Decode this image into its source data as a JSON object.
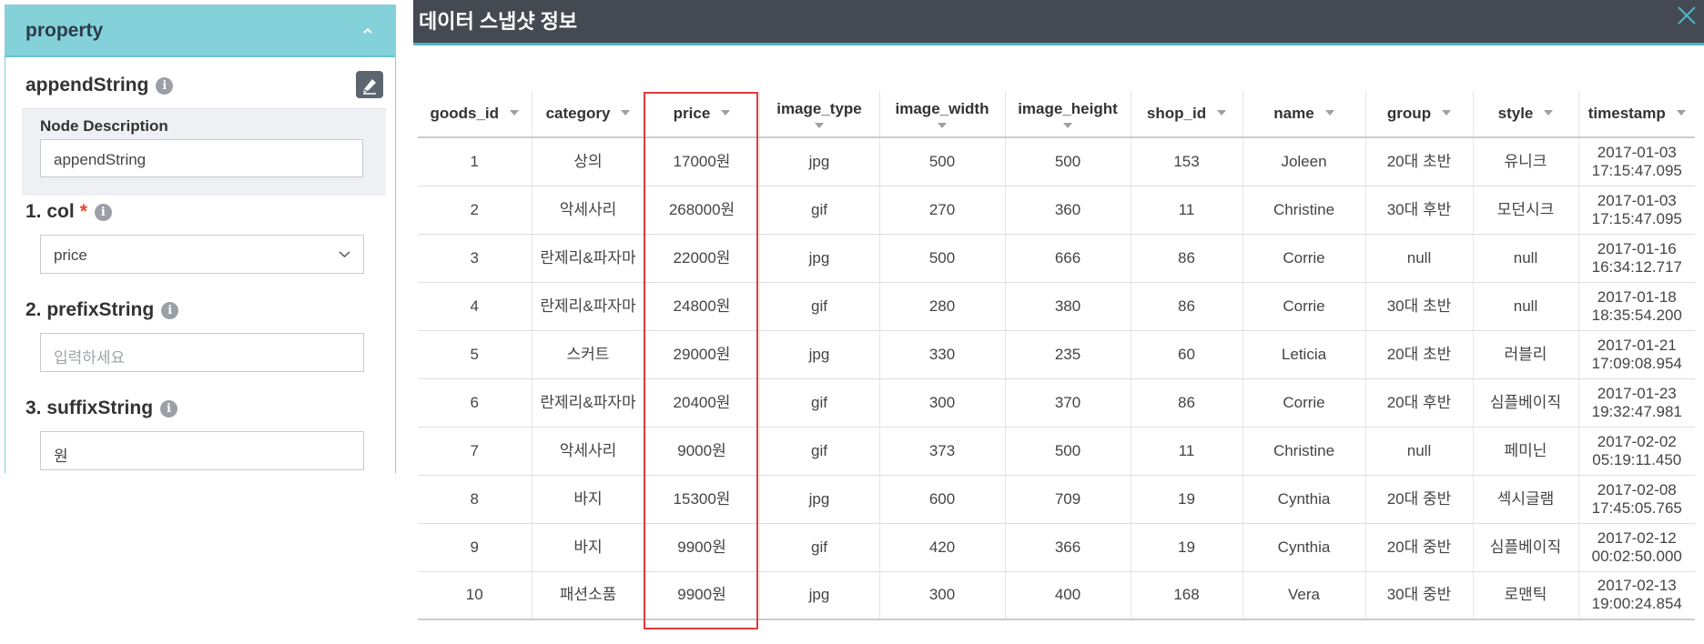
{
  "property_panel": {
    "title": "property",
    "node_name": "appendString",
    "description_label": "Node Description",
    "description_value": "appendString",
    "fields": [
      {
        "label": "1. col",
        "required": "*",
        "value": "price"
      },
      {
        "label": "2. prefixString",
        "placeholder": "입력하세요"
      },
      {
        "label": "3. suffixString",
        "value": "원"
      }
    ]
  },
  "snapshot": {
    "title": "데이터 스냅샷 정보",
    "columns": [
      "goods_id",
      "category",
      "price",
      "image_type",
      "image_width",
      "image_height",
      "shop_id",
      "name",
      "group",
      "style",
      "timestamp"
    ],
    "rows": [
      {
        "goods_id": "1",
        "category": "상의",
        "price": "17000원",
        "image_type": "jpg",
        "image_width": "500",
        "image_height": "500",
        "shop_id": "153",
        "name": "Joleen",
        "group": "20대 초반",
        "style": "유니크",
        "date": "2017-01-03",
        "time": "17:15:47.095"
      },
      {
        "goods_id": "2",
        "category": "악세사리",
        "price": "268000원",
        "image_type": "gif",
        "image_width": "270",
        "image_height": "360",
        "shop_id": "11",
        "name": "Christine",
        "group": "30대 후반",
        "style": "모던시크",
        "date": "2017-01-03",
        "time": "17:15:47.095"
      },
      {
        "goods_id": "3",
        "category": "란제리&파자마",
        "price": "22000원",
        "image_type": "jpg",
        "image_width": "500",
        "image_height": "666",
        "shop_id": "86",
        "name": "Corrie",
        "group": "null",
        "style": "null",
        "date": "2017-01-16",
        "time": "16:34:12.717"
      },
      {
        "goods_id": "4",
        "category": "란제리&파자마",
        "price": "24800원",
        "image_type": "gif",
        "image_width": "280",
        "image_height": "380",
        "shop_id": "86",
        "name": "Corrie",
        "group": "30대 초반",
        "style": "null",
        "date": "2017-01-18",
        "time": "18:35:54.200"
      },
      {
        "goods_id": "5",
        "category": "스커트",
        "price": "29000원",
        "image_type": "jpg",
        "image_width": "330",
        "image_height": "235",
        "shop_id": "60",
        "name": "Leticia",
        "group": "20대 초반",
        "style": "러블리",
        "date": "2017-01-21",
        "time": "17:09:08.954"
      },
      {
        "goods_id": "6",
        "category": "란제리&파자마",
        "price": "20400원",
        "image_type": "gif",
        "image_width": "300",
        "image_height": "370",
        "shop_id": "86",
        "name": "Corrie",
        "group": "20대 후반",
        "style": "심플베이직",
        "date": "2017-01-23",
        "time": "19:32:47.981"
      },
      {
        "goods_id": "7",
        "category": "악세사리",
        "price": "9000원",
        "image_type": "gif",
        "image_width": "373",
        "image_height": "500",
        "shop_id": "11",
        "name": "Christine",
        "group": "null",
        "style": "페미닌",
        "date": "2017-02-02",
        "time": "05:19:11.450"
      },
      {
        "goods_id": "8",
        "category": "바지",
        "price": "15300원",
        "image_type": "jpg",
        "image_width": "600",
        "image_height": "709",
        "shop_id": "19",
        "name": "Cynthia",
        "group": "20대 중반",
        "style": "섹시글램",
        "date": "2017-02-08",
        "time": "17:45:05.765"
      },
      {
        "goods_id": "9",
        "category": "바지",
        "price": "9900원",
        "image_type": "gif",
        "image_width": "420",
        "image_height": "366",
        "shop_id": "19",
        "name": "Cynthia",
        "group": "20대 중반",
        "style": "심플베이직",
        "date": "2017-02-12",
        "time": "00:02:50.000"
      },
      {
        "goods_id": "10",
        "category": "패션소품",
        "price": "9900원",
        "image_type": "jpg",
        "image_width": "300",
        "image_height": "400",
        "shop_id": "168",
        "name": "Vera",
        "group": "30대 중반",
        "style": "로맨틱",
        "date": "2017-02-13",
        "time": "19:00:24.854"
      }
    ]
  },
  "colors": {
    "panel_header": "#84d1da",
    "dialog_header": "#454a52",
    "highlight": "#e03a3a"
  }
}
